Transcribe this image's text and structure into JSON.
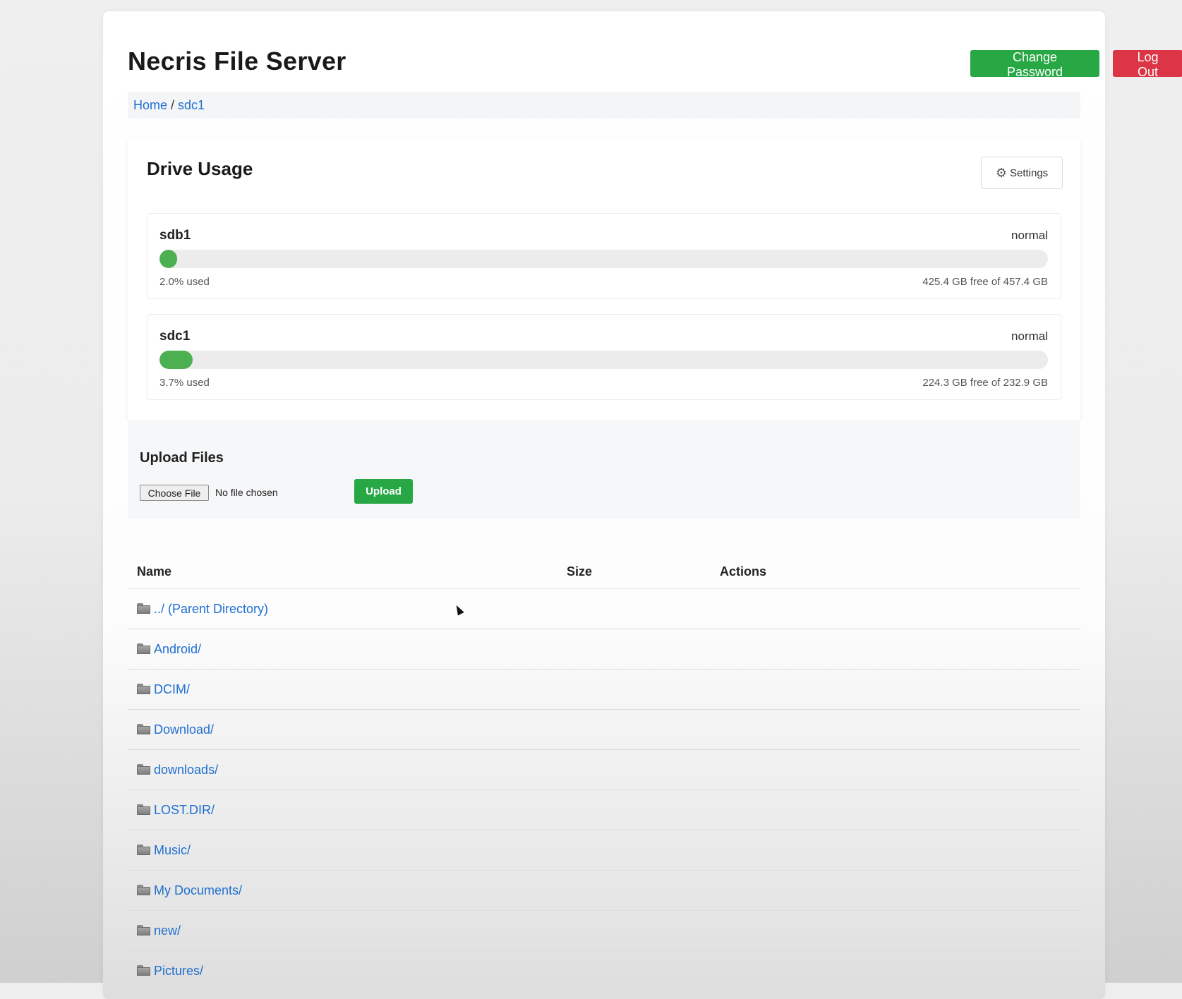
{
  "header": {
    "title": "Necris File Server",
    "change_password_label": "Change Password",
    "logout_label": "Log Out"
  },
  "breadcrumb": {
    "home": "Home",
    "separator": "/",
    "current": "sdc1"
  },
  "drive_usage": {
    "title": "Drive Usage",
    "settings_label": "Settings",
    "settings_icon": "gear-icon",
    "drives": [
      {
        "name": "sdb1",
        "status": "normal",
        "percent_used": 2.0,
        "used_text": "2.0% used",
        "free_text": "425.4 GB free of 457.4 GB"
      },
      {
        "name": "sdc1",
        "status": "normal",
        "percent_used": 3.7,
        "used_text": "3.7% used",
        "free_text": "224.3 GB free of 232.9 GB"
      }
    ]
  },
  "upload": {
    "title": "Upload Files",
    "choose_file_label": "Choose File",
    "no_file_text": "No file chosen",
    "upload_label": "Upload"
  },
  "file_table": {
    "columns": [
      "Name",
      "Size",
      "Actions"
    ],
    "rows": [
      {
        "name": "../ (Parent Directory)",
        "icon": "folder-icon"
      },
      {
        "name": "Android/",
        "icon": "folder-icon"
      },
      {
        "name": "DCIM/",
        "icon": "folder-icon"
      },
      {
        "name": "Download/",
        "icon": "folder-icon"
      },
      {
        "name": "downloads/",
        "icon": "folder-icon"
      },
      {
        "name": "LOST.DIR/",
        "icon": "folder-icon"
      },
      {
        "name": "Music/",
        "icon": "folder-icon"
      },
      {
        "name": "My Documents/",
        "icon": "folder-icon"
      },
      {
        "name": "new/",
        "icon": "folder-icon"
      },
      {
        "name": "Pictures/",
        "icon": "folder-icon"
      }
    ]
  },
  "colors": {
    "accent_green": "#28a745",
    "danger_red": "#dc3545",
    "link_blue": "#1f6fd1",
    "bar_fill": "#4caf50"
  }
}
